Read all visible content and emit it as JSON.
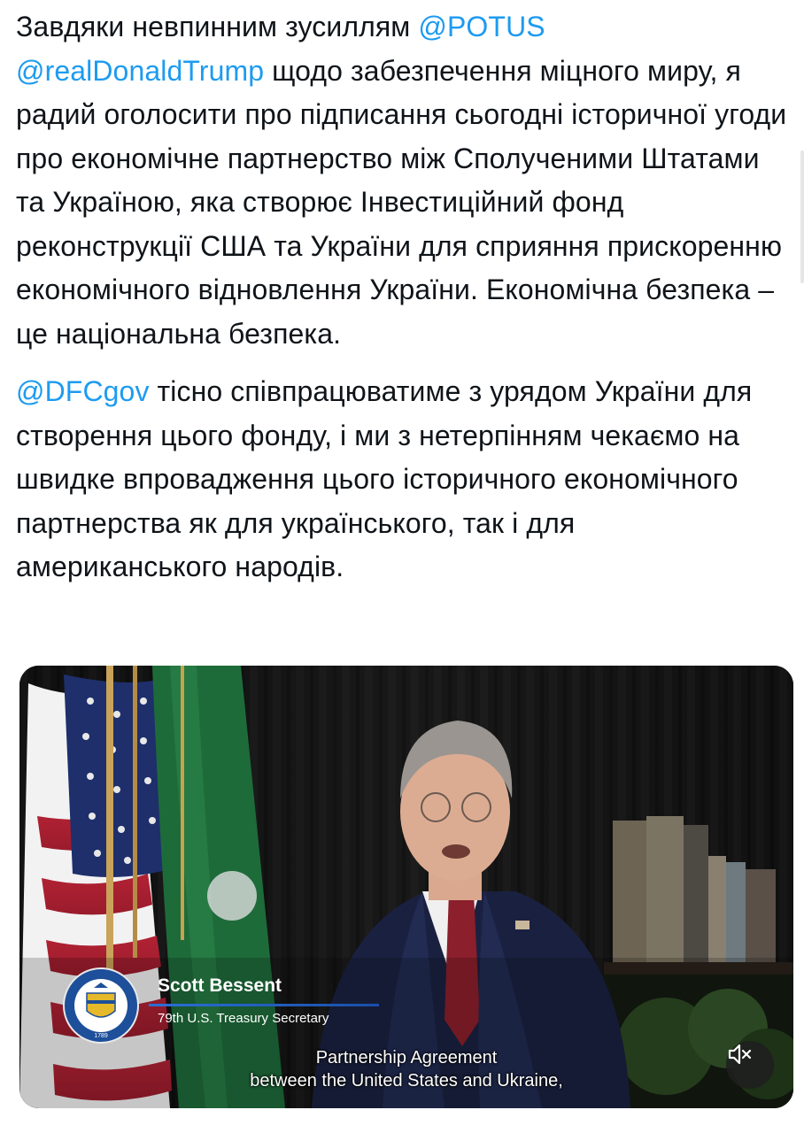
{
  "tweet": {
    "paragraph1": [
      {
        "type": "text",
        "value": "Завдяки невпинним зусиллям "
      },
      {
        "type": "mention",
        "value": "@POTUS"
      },
      {
        "type": "text",
        "value": " "
      },
      {
        "type": "mention",
        "value": "@realDonaldTrump"
      },
      {
        "type": "text",
        "value": " щодо забезпечення міцного миру, я радий оголосити про підписання сьогодні історичної угоди про економічне партнерство між Сполученими Штатами та Україною, яка створює Інвестиційний фонд реконструкції США та України для сприяння прискоренню економічного відновлення України. Економічна безпека – це національна безпека."
      }
    ],
    "paragraph2": [
      {
        "type": "mention",
        "value": "@DFCgov"
      },
      {
        "type": "text",
        "value": " тісно співпрацюватиме з урядом України для створення цього фонду, і ми з нетерпінням чекаємо на швидке впровадження цього історичного економічного партнерства як для українського, так і для американського народів."
      }
    ]
  },
  "video": {
    "speaker_name": "Scott Bessent",
    "speaker_title": "79th U.S. Treasury Secretary",
    "caption_line1": "Partnership Agreement",
    "caption_line2": "between the United States and Ukraine,",
    "seal_year": "1789",
    "mute_icon": "speaker-muted-icon"
  },
  "colors": {
    "mention": "#1d9bf0",
    "text": "#0f1419",
    "treasury_green": "#1e6b3a",
    "seal_blue": "#1d4f9a"
  }
}
